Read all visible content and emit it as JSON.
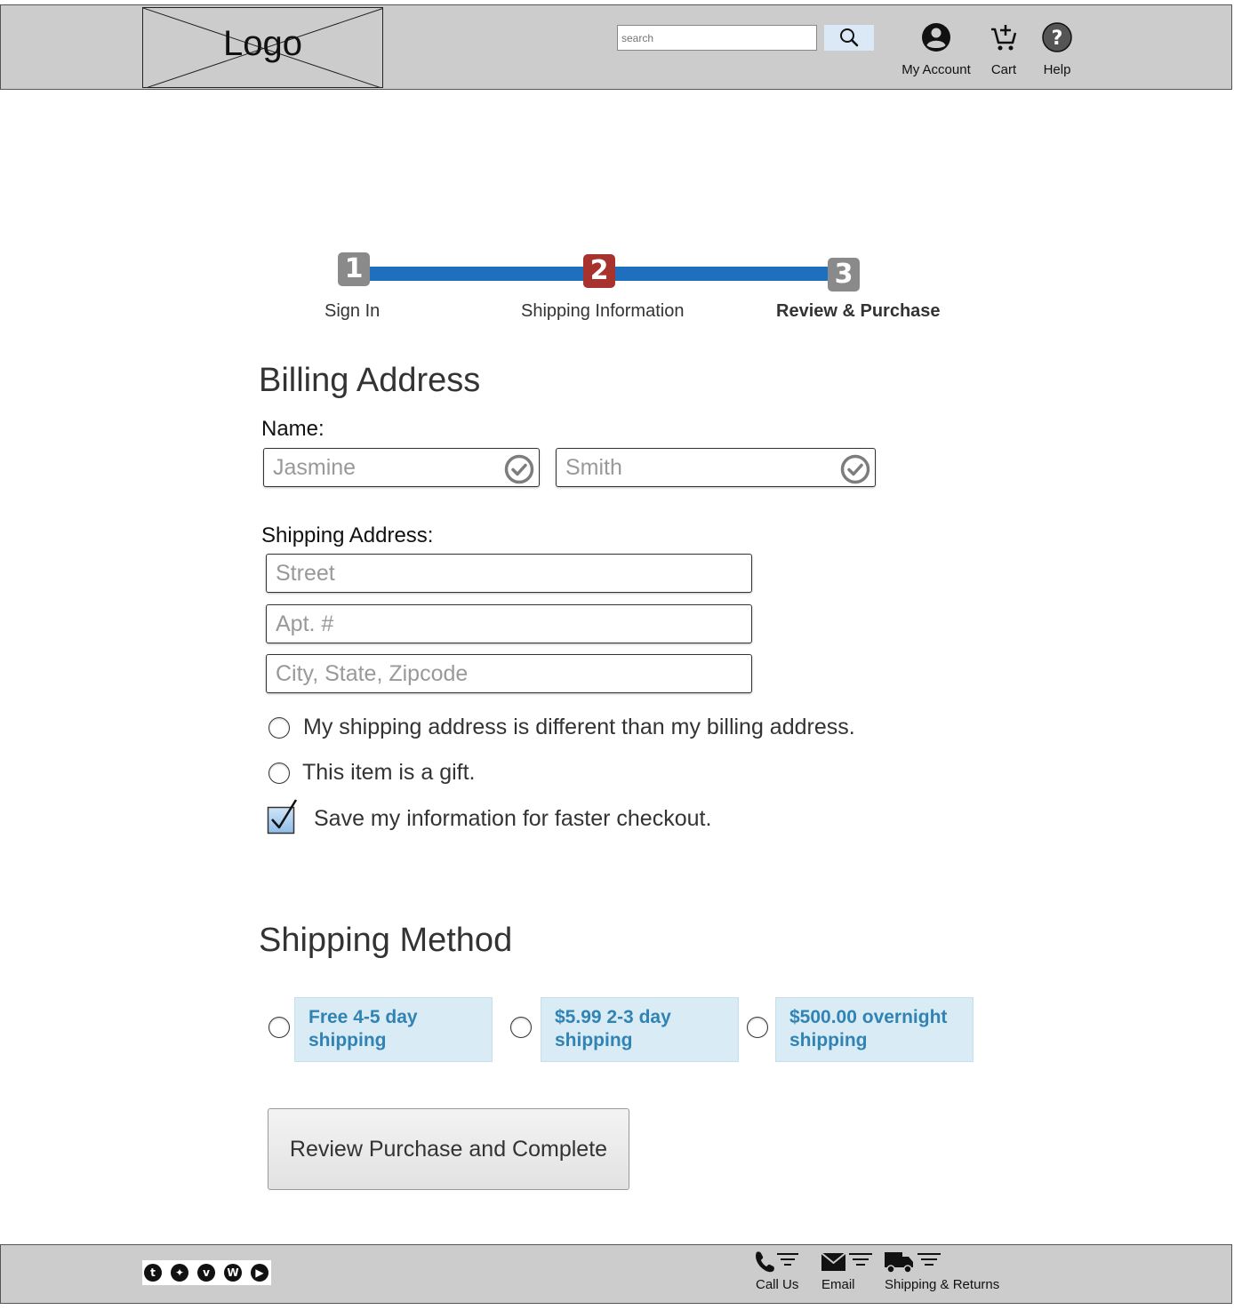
{
  "header": {
    "logo_text": "Logo",
    "search_placeholder": "search",
    "nav": [
      {
        "label": "My Account",
        "icon": "account-circle-icon"
      },
      {
        "label": "Cart",
        "icon": "cart-add-icon"
      },
      {
        "label": "Help",
        "icon": "help-circle-icon"
      }
    ]
  },
  "stepper": {
    "steps": [
      {
        "number": "1",
        "label": "Sign In",
        "color": "#8a8a8a"
      },
      {
        "number": "2",
        "label": "Shipping Information",
        "color": "#a8322d"
      },
      {
        "number": "3",
        "label": "Review & Purchase",
        "color": "#8a8a8a"
      }
    ],
    "bar_color": "#1f6fbf",
    "current_step": 2
  },
  "billing": {
    "title": "Billing Address",
    "name_label": "Name:",
    "first_name_placeholder": "Jasmine",
    "last_name_placeholder": "Smith",
    "shipping_label": "Shipping Address:",
    "street_placeholder": "Street",
    "apt_placeholder": "Apt. #",
    "city_placeholder": "City, State, Zipcode",
    "options": [
      {
        "label": "My shipping address is different than my billing address.",
        "type": "radio",
        "checked": false
      },
      {
        "label": "This item is a gift.",
        "type": "radio",
        "checked": false
      },
      {
        "label": "Save my information for faster checkout.",
        "type": "checkbox",
        "checked": true
      }
    ]
  },
  "shipping_method": {
    "title": "Shipping Method",
    "options": [
      {
        "label": "Free 4-5 day shipping"
      },
      {
        "label": "$5.99 2-3 day shipping"
      },
      {
        "label": "$500.00 overnight shipping"
      }
    ],
    "accent_color": "#3183b4"
  },
  "actions": {
    "review_label": "Review Purchase and Complete"
  },
  "footer": {
    "social_icons": [
      "tumblr-icon",
      "twitter-icon",
      "vimeo-icon",
      "wordpress-icon",
      "youtube-icon"
    ],
    "links": [
      {
        "label": "Call Us",
        "icon": "phone-icon"
      },
      {
        "label": "Email",
        "icon": "envelope-icon"
      },
      {
        "label": "Shipping & Returns",
        "icon": "truck-icon"
      }
    ]
  }
}
